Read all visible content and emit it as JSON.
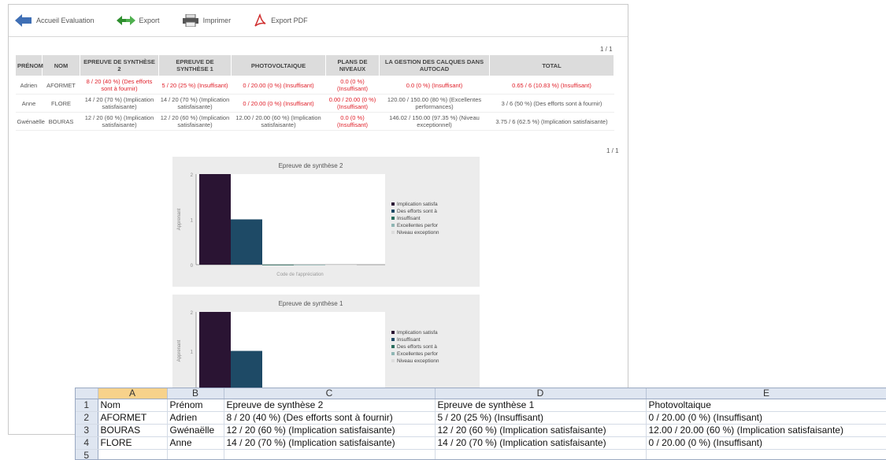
{
  "toolbar": {
    "back_label": "Accueil Evaluation",
    "export_label": "Export",
    "print_label": "Imprimer",
    "pdf_label": "Export PDF"
  },
  "pager": {
    "top": "1 / 1",
    "bottom": "1 / 1"
  },
  "grades": {
    "headers": [
      "PRÉNOM",
      "NOM",
      "EPREUVE DE SYNTHÈSE 2",
      "EPREUVE DE SYNTHÈSE 1",
      "PHOTOVOLTAIQUE",
      "PLANS DE NIVEAUX",
      "LA GESTION DES CALQUES DANS AUTOCAD",
      "TOTAL"
    ],
    "rows": [
      {
        "prenom": "Adrien",
        "nom": "AFORMET",
        "s2": "8 / 20 (40 %) (Des efforts sont à fournir)",
        "s1": "5 / 20 (25 %) (Insuffisant)",
        "photo": "0 / 20.00 (0 %) (Insuffisant)",
        "plans": "0.0 (0 %) (Insuffisant)",
        "calques": "0.0 (0 %) (Insuffisant)",
        "total": "0.65 / 6 (10.83 %) (Insuffisant)"
      },
      {
        "prenom": "Anne",
        "nom": "FLORE",
        "s2": "14 / 20 (70 %) (Implication satisfaisante)",
        "s1": "14 / 20 (70 %) (Implication satisfaisante)",
        "photo": "0 / 20.00 (0 %) (Insuffisant)",
        "plans": "0.00 / 20.00 (0 %) (Insuffisant)",
        "calques": "120.00 / 150.00 (80 %) (Excellentes performances)",
        "total": "3 / 6 (50 %) (Des efforts sont à fournir)"
      },
      {
        "prenom": "Gwénaëlle",
        "nom": "BOURAS",
        "s2": "12 / 20 (60 %) (Implication satisfaisante)",
        "s1": "12 / 20 (60 %) (Implication satisfaisante)",
        "photo": "12.00 / 20.00 (60 %) (Implication satisfaisante)",
        "plans": "0.0 (0 %) (Insuffisant)",
        "calques": "146.02 / 150.00 (97.35 %) (Niveau exceptionnel)",
        "total": "3.75 / 6 (62.5 %) (Implication satisfaisante)"
      }
    ]
  },
  "chart_data": [
    {
      "type": "bar",
      "title": "Epreuve de synthèse 2",
      "ylabel": "Apprenant",
      "xlabel": "Code de l'appréciation",
      "categories": [
        "Implication satisfa",
        "Des efforts sont à",
        "Insuffisant",
        "Excellentes perfor",
        "Niveau exceptionn"
      ],
      "values": [
        2,
        1,
        0,
        0,
        0
      ],
      "ylim": [
        0,
        2
      ],
      "colors": [
        "#2a1433",
        "#1e4a66",
        "#2a6e5e",
        "#8fb6b4",
        "#dcdcdc"
      ],
      "legend": [
        "Implication satisfa",
        "Des efforts sont à",
        "Insuffisant",
        "Excellentes perfor",
        "Niveau exceptionn"
      ]
    },
    {
      "type": "bar",
      "title": "Epreuve de synthèse 1",
      "ylabel": "Apprenant",
      "categories": [
        "Implication satisfa",
        "Insuffisant",
        "Des efforts sont à",
        "Excellentes perfor",
        "Niveau exceptionn"
      ],
      "values": [
        2,
        1,
        0,
        0,
        0
      ],
      "ylim": [
        0,
        2
      ],
      "colors": [
        "#2a1433",
        "#1e4a66",
        "#2a6e5e",
        "#8fb6b4",
        "#dcdcdc"
      ],
      "legend": [
        "Implication satisfa",
        "Insuffisant",
        "Des efforts sont à",
        "Excellentes perfor",
        "Niveau exceptionn"
      ]
    }
  ],
  "sheet": {
    "columns": [
      "A",
      "B",
      "C",
      "D",
      "E"
    ],
    "rows": [
      {
        "n": "1",
        "cells": [
          "Nom",
          "Prénom",
          "Epreuve de synthèse 2",
          "Epreuve de synthèse 1",
          "Photovoltaique"
        ]
      },
      {
        "n": "2",
        "cells": [
          "AFORMET",
          "Adrien",
          "8 / 20 (40 %) (Des efforts sont à fournir)",
          "5 / 20 (25 %) (Insuffisant)",
          "0 / 20.00 (0 %) (Insuffisant)"
        ]
      },
      {
        "n": "3",
        "cells": [
          "BOURAS",
          "Gwénaëlle",
          "12 / 20 (60 %) (Implication satisfaisante)",
          "12 / 20 (60 %) (Implication satisfaisante)",
          "12.00 / 20.00 (60 %) (Implication satisfaisante)"
        ]
      },
      {
        "n": "4",
        "cells": [
          "FLORE",
          "Anne",
          "14 / 20 (70 %) (Implication satisfaisante)",
          "14 / 20 (70 %) (Implication satisfaisante)",
          "0 / 20.00 (0 %) (Insuffisant)"
        ]
      },
      {
        "n": "5",
        "cells": [
          "",
          "",
          "",
          "",
          ""
        ]
      }
    ]
  }
}
